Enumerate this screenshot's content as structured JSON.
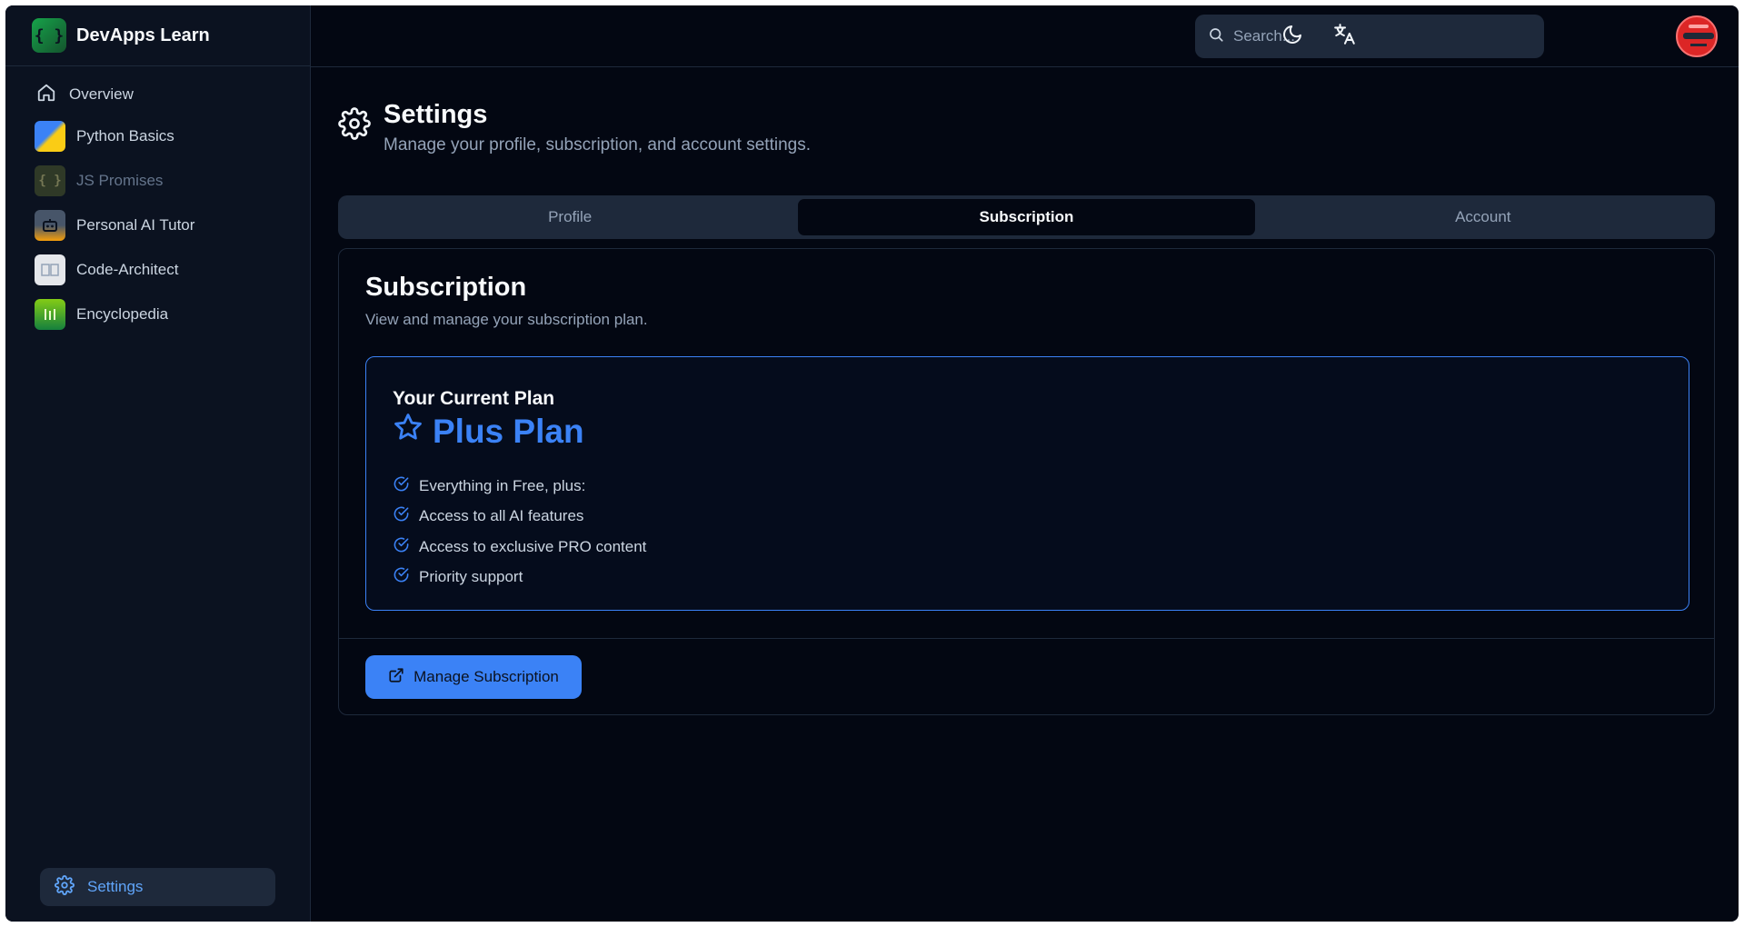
{
  "brand": {
    "name": "DevApps Learn",
    "logo_glyph": "{ }"
  },
  "sidebar": {
    "items": [
      {
        "label": "Overview",
        "icon": "home-icon"
      },
      {
        "label": "Python Basics",
        "icon": "python-thumbnail"
      },
      {
        "label": "JS Promises",
        "icon": "js-thumbnail",
        "glyph": "{ }"
      },
      {
        "label": "Personal AI Tutor",
        "icon": "robot-thumbnail"
      },
      {
        "label": "Code-Architect",
        "icon": "code-architect-thumbnail"
      },
      {
        "label": "Encyclopedia",
        "icon": "encyclopedia-thumbnail"
      }
    ],
    "settings_label": "Settings"
  },
  "topbar": {
    "search_placeholder": "Search...",
    "theme_icon": "moon-icon",
    "language_icon": "translate-icon"
  },
  "page": {
    "title": "Settings",
    "subtitle": "Manage your profile, subscription, and account settings."
  },
  "tabs": [
    {
      "label": "Profile",
      "active": false
    },
    {
      "label": "Subscription",
      "active": true
    },
    {
      "label": "Account",
      "active": false
    }
  ],
  "subscription": {
    "title": "Subscription",
    "description": "View and manage your subscription plan.",
    "current_plan_label": "Your Current Plan",
    "plan_name": "Plus Plan",
    "features": [
      "Everything in Free, plus:",
      "Access to all AI features",
      "Access to exclusive PRO content",
      "Priority support"
    ],
    "manage_label": "Manage Subscription"
  },
  "colors": {
    "background": "#030712",
    "sidebar": "#0b1220",
    "accent": "#3b82f6",
    "surface": "#1e293b"
  }
}
